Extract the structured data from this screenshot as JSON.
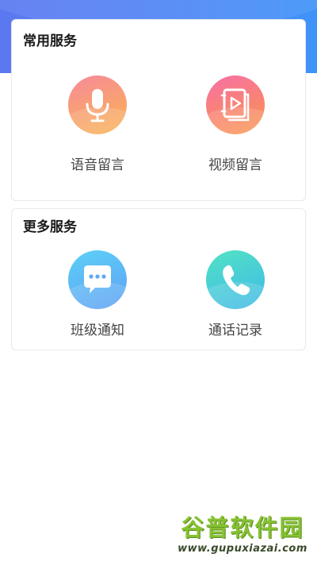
{
  "header": {
    "accent_color": "#4f86f6"
  },
  "common_services": {
    "title": "常用服务",
    "items": [
      {
        "label": "语音留言",
        "icon": "microphone-icon",
        "color": "#f8a36c"
      },
      {
        "label": "视频留言",
        "icon": "video-play-icon",
        "color": "#f8866d"
      }
    ]
  },
  "more_services": {
    "title": "更多服务",
    "items": [
      {
        "label": "班级通知",
        "icon": "chat-bubble-icon",
        "color": "#5fa9f5"
      },
      {
        "label": "通话记录",
        "icon": "phone-icon",
        "color": "#3fc8d8"
      }
    ]
  },
  "watermark": {
    "title": "谷普软件园",
    "url": "www.gupuxiazai.com",
    "color": "#86c232"
  }
}
